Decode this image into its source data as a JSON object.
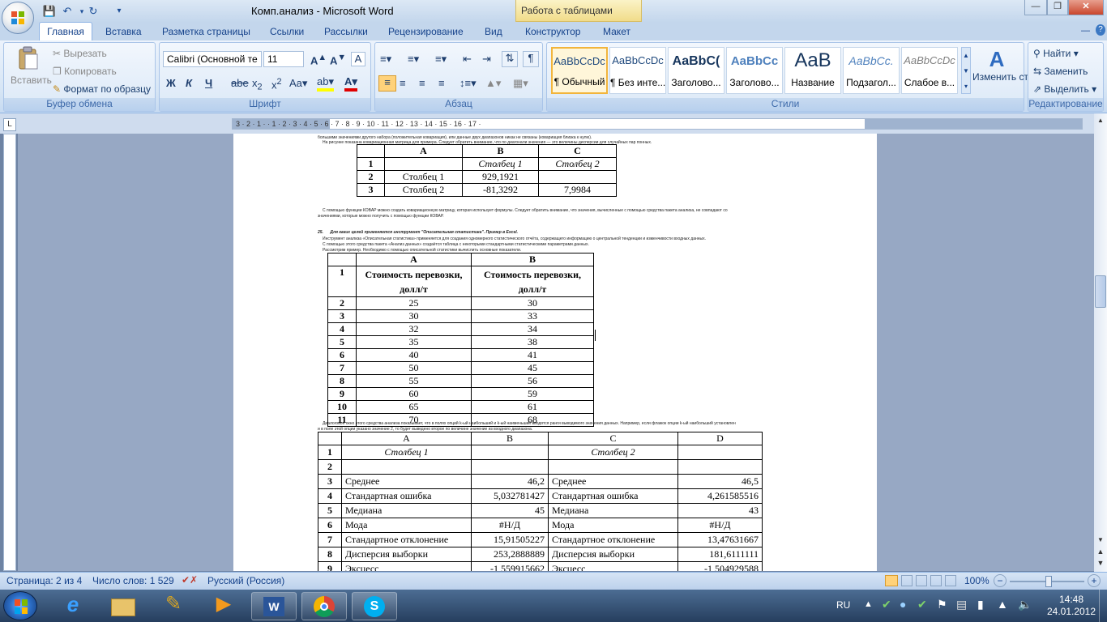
{
  "window": {
    "title": "Комп.анализ - Microsoft Word",
    "context_tab": "Работа с таблицами"
  },
  "tabs": [
    "Главная",
    "Вставка",
    "Разметка страницы",
    "Ссылки",
    "Рассылки",
    "Рецензирование",
    "Вид",
    "Конструктор",
    "Макет"
  ],
  "clipboard": {
    "paste": "Вставить",
    "cut": "Вырезать",
    "copy": "Копировать",
    "format_painter": "Формат по образцу",
    "label": "Буфер обмена"
  },
  "font": {
    "name": "Calibri (Основной те",
    "size": "11",
    "label": "Шрифт"
  },
  "paragraph": {
    "label": "Абзац"
  },
  "styles": {
    "items": [
      {
        "preview": "AaBbCcDc",
        "name": "¶ Обычный"
      },
      {
        "preview": "AaBbCcDc",
        "name": "¶ Без инте..."
      },
      {
        "preview": "AaBbC(",
        "name": "Заголово..."
      },
      {
        "preview": "AaBbCc",
        "name": "Заголово..."
      },
      {
        "preview": "AaB",
        "name": "Название"
      },
      {
        "preview": "AaBbCc.",
        "name": "Подзагол..."
      },
      {
        "preview": "AaBbCcDc",
        "name": "Слабое в..."
      }
    ],
    "change": "Изменить стили",
    "label": "Стили"
  },
  "editing": {
    "find": "Найти",
    "replace": "Заменить",
    "select": "Выделить",
    "label": "Редактирование"
  },
  "ruler": {
    "marks": "3 · 2 · 1 · · 1 · 2 · 3 · 4 · 5 · 6 · 7 · 8 · 9 · 10 · 11 · 12 · 13 · 14 · 15 · 16 · 17 ·"
  },
  "doc": {
    "t1": {
      "cols": [
        "A",
        "B",
        "C"
      ],
      "rows": [
        [
          "1",
          "",
          "Столбец 1",
          "Столбец 2"
        ],
        [
          "2",
          "Столбец 1",
          "929,1921",
          ""
        ],
        [
          "3",
          "Столбец 2",
          "-81,3292",
          "7,9984"
        ]
      ]
    },
    "t2": {
      "cols": [
        "A",
        "B"
      ],
      "header": [
        "1",
        "Стоимость перевозки, долл/т",
        "Стоимость перевозки, долл/т"
      ],
      "rows": [
        [
          "2",
          "25",
          "30"
        ],
        [
          "3",
          "30",
          "33"
        ],
        [
          "4",
          "32",
          "34"
        ],
        [
          "5",
          "35",
          "38"
        ],
        [
          "6",
          "40",
          "41"
        ],
        [
          "7",
          "50",
          "45"
        ],
        [
          "8",
          "55",
          "56"
        ],
        [
          "9",
          "60",
          "59"
        ],
        [
          "10",
          "65",
          "61"
        ],
        [
          "11",
          "70",
          "68"
        ]
      ]
    },
    "t3": {
      "cols": [
        "A",
        "B",
        "C",
        "D"
      ],
      "rows": [
        [
          "1",
          "Столбец 1",
          "",
          "Столбец 2",
          ""
        ],
        [
          "2",
          "",
          "",
          "",
          ""
        ],
        [
          "3",
          "Среднее",
          "46,2",
          "Среднее",
          "46,5"
        ],
        [
          "4",
          "Стандартная ошибка",
          "5,032781427",
          "Стандартная ошибка",
          "4,261585516"
        ],
        [
          "5",
          "Медиана",
          "45",
          "Медиана",
          "43"
        ],
        [
          "6",
          "Мода",
          "#Н/Д",
          "Мода",
          "#Н/Д"
        ],
        [
          "7",
          "Стандартное отклонение",
          "15,91505227",
          "Стандартное отклонение",
          "13,47631667"
        ],
        [
          "8",
          "Дисперсия выборки",
          "253,2888889",
          "Дисперсия выборки",
          "181,6111111"
        ],
        [
          "9",
          "Эксцесс",
          "-1,559915662",
          "Эксцесс",
          "-1,504929588"
        ]
      ]
    }
  },
  "status": {
    "page": "Страница: 2 из 4",
    "words": "Число слов: 1 529",
    "lang": "Русский (Россия)",
    "zoom": "100%"
  },
  "taskbar": {
    "lang": "RU",
    "time": "14:48",
    "date": "24.01.2012"
  }
}
